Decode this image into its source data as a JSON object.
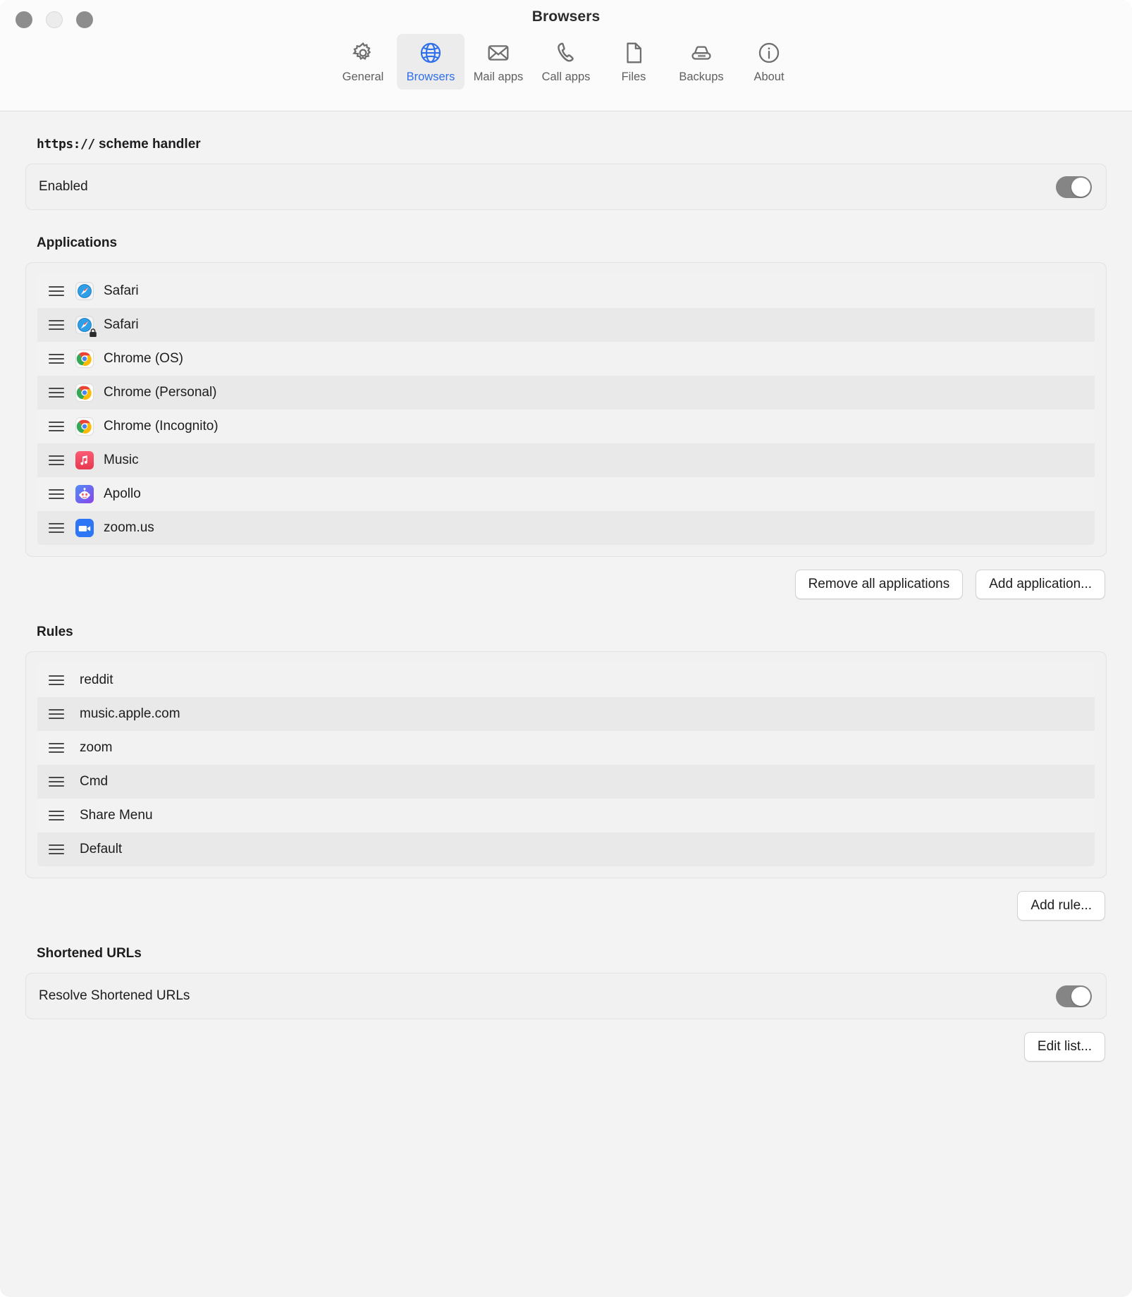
{
  "window": {
    "title": "Browsers",
    "traffic_lights": [
      "close",
      "minimize",
      "zoom"
    ]
  },
  "toolbar": {
    "items": [
      {
        "id": "general",
        "label": "General",
        "icon": "gear-icon",
        "selected": false
      },
      {
        "id": "browsers",
        "label": "Browsers",
        "icon": "globe-icon",
        "selected": true
      },
      {
        "id": "mail-apps",
        "label": "Mail apps",
        "icon": "envelope-icon",
        "selected": false
      },
      {
        "id": "call-apps",
        "label": "Call apps",
        "icon": "phone-icon",
        "selected": false
      },
      {
        "id": "files",
        "label": "Files",
        "icon": "document-icon",
        "selected": false
      },
      {
        "id": "backups",
        "label": "Backups",
        "icon": "drive-icon",
        "selected": false
      },
      {
        "id": "about",
        "label": "About",
        "icon": "info-icon",
        "selected": false
      }
    ],
    "selected_accent": "#2f6fec"
  },
  "scheme_handler": {
    "heading_mono": "https://",
    "heading_rest": " scheme handler",
    "heading_full": "https:// scheme handler",
    "enabled_label": "Enabled",
    "enabled_on": true
  },
  "applications": {
    "heading": "Applications",
    "items": [
      {
        "label": "Safari",
        "icon": "safari-icon"
      },
      {
        "label": "Safari",
        "icon": "safari-private-icon"
      },
      {
        "label": "Chrome (OS)",
        "icon": "chrome-icon"
      },
      {
        "label": "Chrome (Personal)",
        "icon": "chrome-icon"
      },
      {
        "label": "Chrome (Incognito)",
        "icon": "chrome-icon"
      },
      {
        "label": "Music",
        "icon": "music-icon"
      },
      {
        "label": "Apollo",
        "icon": "apollo-icon"
      },
      {
        "label": "zoom.us",
        "icon": "zoom-icon"
      }
    ],
    "remove_all_label": "Remove all applications",
    "add_label": "Add application..."
  },
  "rules": {
    "heading": "Rules",
    "items": [
      {
        "label": "reddit"
      },
      {
        "label": "music.apple.com"
      },
      {
        "label": "zoom"
      },
      {
        "label": "Cmd"
      },
      {
        "label": "Share Menu"
      },
      {
        "label": "Default"
      }
    ],
    "add_label": "Add rule..."
  },
  "shortened_urls": {
    "heading": "Shortened URLs",
    "resolve_label": "Resolve Shortened URLs",
    "resolve_on": true,
    "edit_label": "Edit list..."
  },
  "colors": {
    "accent": "#2f6fec",
    "window_bg": "#f3f3f3",
    "titlebar_bg": "#fbfbfb",
    "row_odd": "#f2f2f2",
    "row_even": "#e9e9e9",
    "switch_on": "#858585"
  }
}
